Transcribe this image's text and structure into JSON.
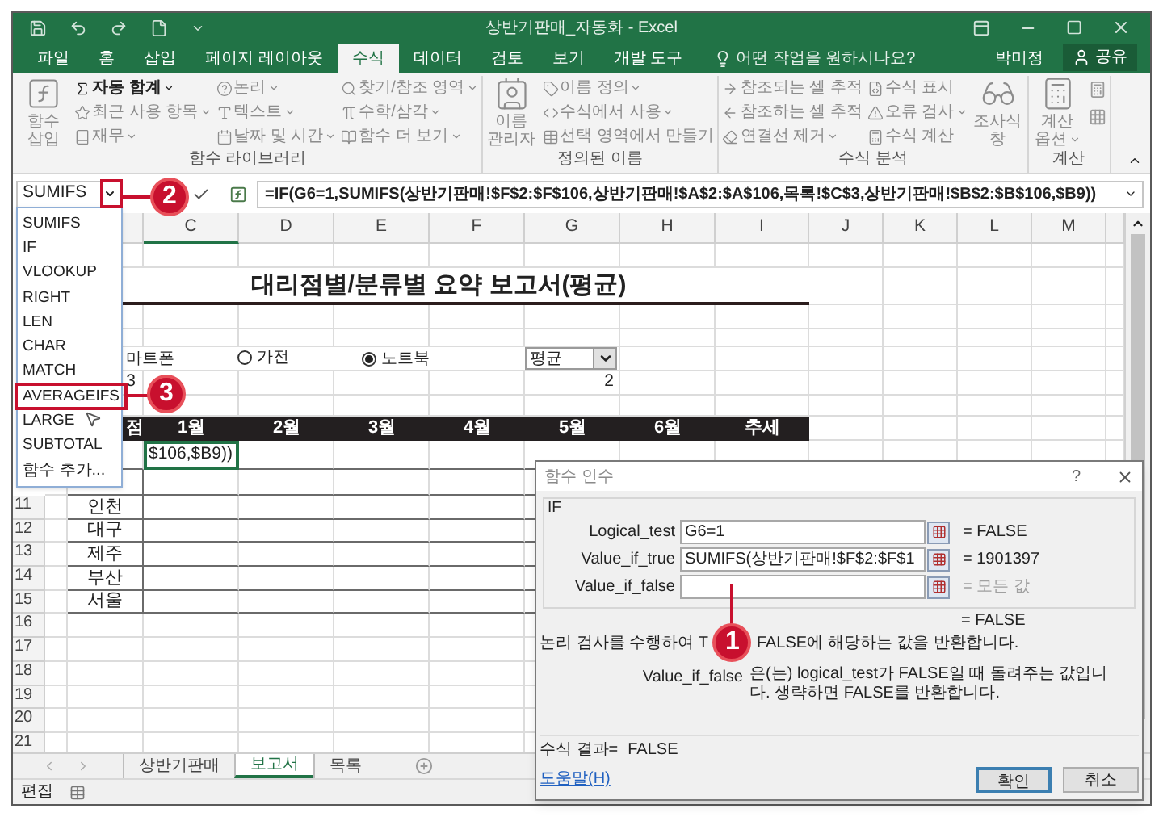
{
  "window": {
    "title": "상반기판매_자동화 - Excel"
  },
  "tabs": [
    {
      "label": "파일",
      "selected": false
    },
    {
      "label": "홈",
      "selected": false
    },
    {
      "label": "삽입",
      "selected": false
    },
    {
      "label": "페이지 레이아웃",
      "selected": false
    },
    {
      "label": "수식",
      "selected": true
    },
    {
      "label": "데이터",
      "selected": false
    },
    {
      "label": "검토",
      "selected": false
    },
    {
      "label": "보기",
      "selected": false
    },
    {
      "label": "개발 도구",
      "selected": false
    }
  ],
  "tell_me": {
    "placeholder": "어떤 작업을 원하시나요?"
  },
  "user": {
    "name": "박미정"
  },
  "share_button": {
    "label": "공유"
  },
  "ribbon": {
    "groups": [
      {
        "label": "함수 라이브러리",
        "columns": [
          {
            "kind": "large",
            "label": "함수 삽입",
            "dropdown": false,
            "disabled": true
          },
          {
            "kind": "stack",
            "items": [
              {
                "label": "자동 합계",
                "dropdown": true,
                "disabled": false
              },
              {
                "label": "최근 사용 항목",
                "dropdown": true,
                "disabled": true
              },
              {
                "label": "재무",
                "dropdown": true,
                "disabled": true
              }
            ]
          },
          {
            "kind": "stack",
            "items": [
              {
                "label": "논리",
                "dropdown": true,
                "disabled": true
              },
              {
                "label": "텍스트",
                "dropdown": true,
                "disabled": true
              },
              {
                "label": "날짜 및 시간",
                "dropdown": true,
                "disabled": true
              }
            ]
          },
          {
            "kind": "stack",
            "items": [
              {
                "label": "찾기/참조 영역",
                "dropdown": true,
                "disabled": true
              },
              {
                "label": "수학/삼각",
                "dropdown": true,
                "disabled": true
              },
              {
                "label": "함수 더 보기",
                "dropdown": true,
                "disabled": true
              }
            ]
          }
        ]
      },
      {
        "label": "정의된 이름",
        "columns": [
          {
            "kind": "large",
            "label": "이름 관리자",
            "dropdown": false,
            "disabled": true
          },
          {
            "kind": "stack",
            "items": [
              {
                "label": "이름 정의",
                "dropdown": true,
                "disabled": true
              },
              {
                "label": "수식에서 사용",
                "dropdown": true,
                "disabled": true
              },
              {
                "label": "선택 영역에서 만들기",
                "dropdown": false,
                "disabled": true
              }
            ]
          }
        ]
      },
      {
        "label": "수식 분석",
        "columns": [
          {
            "kind": "stack",
            "items": [
              {
                "label": "참조되는 셀 추적",
                "dropdown": false,
                "disabled": true
              },
              {
                "label": "참조하는 셀 추적",
                "dropdown": false,
                "disabled": true
              },
              {
                "label": "연결선 제거",
                "dropdown": true,
                "disabled": true
              }
            ]
          },
          {
            "kind": "stack",
            "items": [
              {
                "label": "수식 표시",
                "dropdown": false,
                "disabled": true
              },
              {
                "label": "오류 검사",
                "dropdown": true,
                "disabled": true
              },
              {
                "label": "수식 계산",
                "dropdown": false,
                "disabled": true
              }
            ]
          },
          {
            "kind": "large",
            "label": "조사식 창",
            "dropdown": false,
            "disabled": true
          }
        ]
      },
      {
        "label": "계산",
        "columns": [
          {
            "kind": "large",
            "label": "계산 옵션",
            "dropdown": true,
            "disabled": true
          },
          {
            "kind": "icon_stack"
          }
        ]
      }
    ]
  },
  "name_box": {
    "value": "SUMIFS"
  },
  "formula_bar": {
    "value": "=IF(G6=1,SUMIFS(상반기판매!$F$2:$F$106,상반기판매!$A$2:$A$106,목록!$C$3,상반기판매!$B$2:$B$106,$B9))"
  },
  "function_menu": {
    "items": [
      {
        "label": "SUMIFS",
        "highlighted": false
      },
      {
        "label": "IF",
        "highlighted": false
      },
      {
        "label": "VLOOKUP",
        "highlighted": false
      },
      {
        "label": "RIGHT",
        "highlighted": false
      },
      {
        "label": "LEN",
        "highlighted": false
      },
      {
        "label": "CHAR",
        "highlighted": false
      },
      {
        "label": "MATCH",
        "highlighted": false
      },
      {
        "label": "AVERAGEIFS",
        "highlighted": true
      },
      {
        "label": "LARGE",
        "highlighted": false
      },
      {
        "label": "SUBTOTAL",
        "highlighted": false
      },
      {
        "label": "함수 추가...",
        "highlighted": false
      }
    ]
  },
  "sheet": {
    "column_headers": [
      "C",
      "D",
      "E",
      "F",
      "G",
      "H",
      "I",
      "J",
      "K",
      "L",
      "M"
    ],
    "row_headers": [
      "11",
      "12",
      "13",
      "14",
      "15",
      "16",
      "17",
      "18",
      "19",
      "20",
      "21"
    ],
    "title": "대리점별/분류별 요약 보고서(평균)",
    "partial_option_label": "마트폰",
    "category_options": [
      {
        "label": "가전",
        "selected": false
      },
      {
        "label": "노트북",
        "selected": true
      }
    ],
    "category_number": "3",
    "stat_dropdown": {
      "value": "평균"
    },
    "stat_number": "2",
    "header_band": [
      "점",
      "1월",
      "2월",
      "3월",
      "4월",
      "5월",
      "6월",
      "추세"
    ],
    "active_cell": "$106,$B9))",
    "regions": [
      "인천",
      "대구",
      "제주",
      "부산",
      "서울"
    ]
  },
  "sheet_tabs": [
    {
      "label": "상반기판매",
      "selected": false
    },
    {
      "label": "보고서",
      "selected": true
    },
    {
      "label": "목록",
      "selected": false
    }
  ],
  "status_bar": {
    "mode": "편집"
  },
  "dialog": {
    "title": "함수 인수",
    "help_label": "?",
    "function_name": "IF",
    "arguments": [
      {
        "label": "Logical_test",
        "value": "G6=1",
        "result": "= FALSE",
        "dimmed": false
      },
      {
        "label": "Value_if_true",
        "value": "SUMIFS(상반기판매!$F$2:$F$1",
        "result": "= 1901397",
        "dimmed": false
      },
      {
        "label": "Value_if_false",
        "result": "= 모든 값",
        "dimmed": true
      }
    ],
    "overall_result": "= FALSE",
    "description_parts": [
      "논리 검사를 수행하여 T",
      "FALSE에 해당하는 값을 반환합니다."
    ],
    "argument_help": {
      "name": "Value_if_false",
      "text": "은(는) logical_test가 FALSE일 때 돌려주는 값입니다. 생략하면 FALSE를 반환합니다."
    },
    "formula_result": {
      "label": "수식 결과=",
      "value": "FALSE"
    },
    "help_link": "도움말(H)",
    "buttons": [
      {
        "label": "확인",
        "kind": "primary"
      },
      {
        "label": "취소",
        "kind": "secondary"
      }
    ]
  },
  "callouts": [
    {
      "number": "1"
    },
    {
      "number": "2"
    },
    {
      "number": "3"
    }
  ]
}
